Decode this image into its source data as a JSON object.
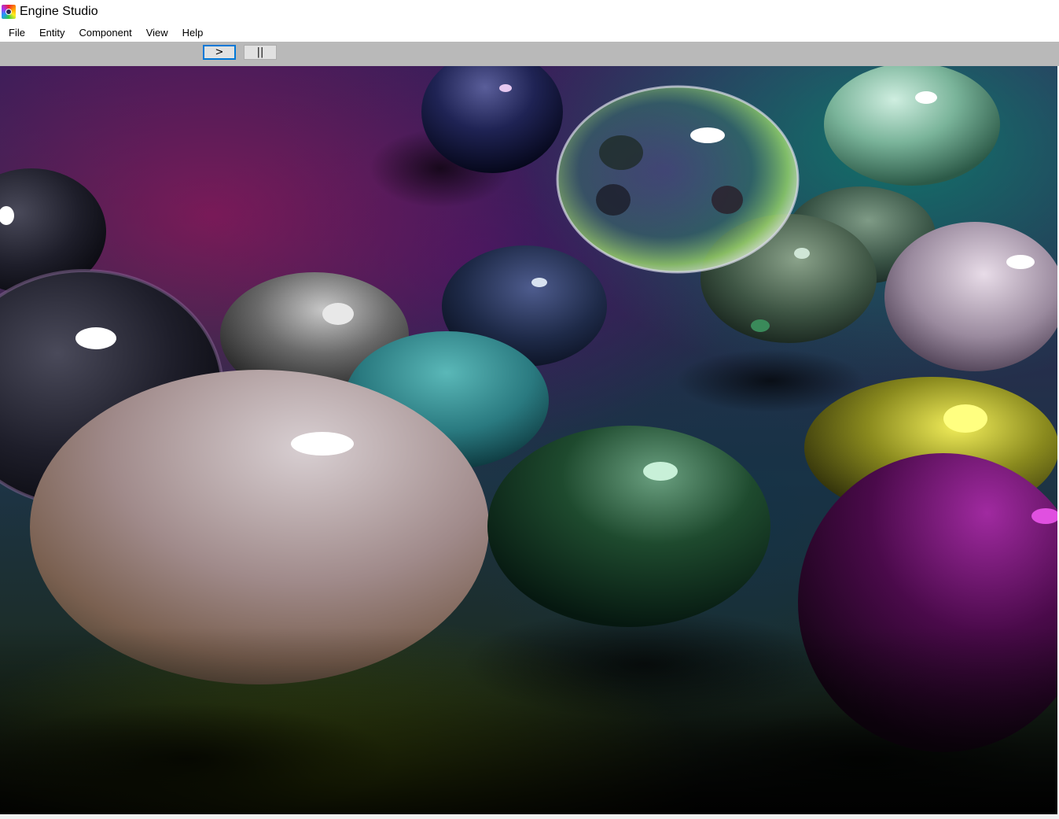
{
  "window": {
    "title": "Engine Studio",
    "icon": "app-logo-icon"
  },
  "menubar": {
    "items": [
      {
        "label": "File"
      },
      {
        "label": "Entity"
      },
      {
        "label": "Component"
      },
      {
        "label": "View"
      },
      {
        "label": "Help"
      }
    ]
  },
  "toolbar": {
    "play_label": ">",
    "pause_label": "||",
    "play_icon": "play-icon",
    "pause_icon": "pause-icon"
  },
  "viewport": {
    "content": "rendered-scene"
  }
}
